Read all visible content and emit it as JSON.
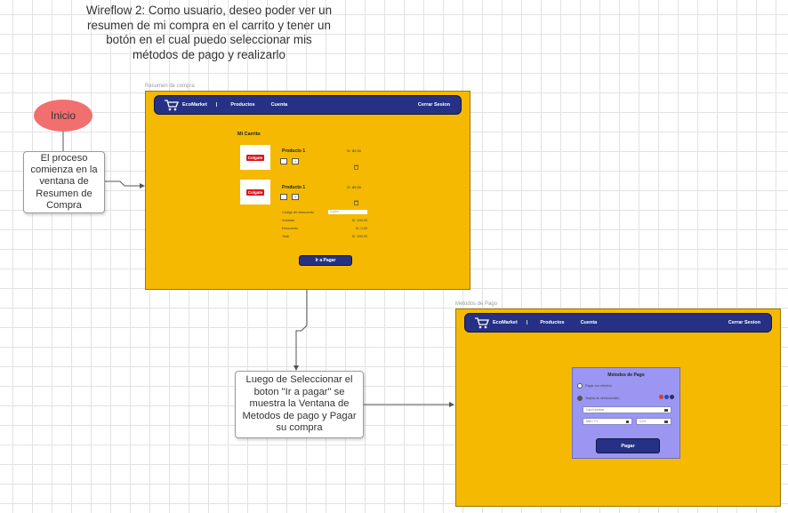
{
  "title": "Wireflow 2: Como usuario, deseo poder ver un resumen de mi compra en el carrito y tener un botón en el cual puedo seleccionar mis métodos de pago y realizarlo",
  "flow": {
    "start": "Inicio",
    "step1": "El proceso comienza en la ventana de Resumen de Compra",
    "step2": "Luego de Seleccionar el boton \"Ir a pagar\" se muestra la Ventana de Metodos de pago y Pagar su compra"
  },
  "colors": {
    "frame": "#f4b900",
    "navbar": "#263185",
    "start_node": "#f26f6f",
    "payment_panel": "#9a96f2"
  },
  "screen1": {
    "label": "Resumen de compra",
    "nav": {
      "brand": "EcoMarket",
      "sep": "|",
      "products": "Productos",
      "account": "Cuenta",
      "logout": "Cerrar Sesion",
      "icon": "shopping-cart-icon"
    },
    "cart_title": "Mi Carrito",
    "products": [
      {
        "brand": "Colgate",
        "name": "Producto 1",
        "price": "S/. 85.90"
      },
      {
        "brand": "Colgate",
        "name": "Producto 1",
        "price": "S/. 85.90"
      }
    ],
    "coupon_label": "Codigo de descuento",
    "coupon_placeholder": "Cupón",
    "subtotal_label": "Subtotal",
    "subtotal_value": "S/. 180.00",
    "discount_label": "Descuento",
    "discount_value": "S/. 0.00",
    "total_label": "Total",
    "total_value": "S/. 180.00",
    "pay_button": "Ir a Pagar"
  },
  "screen2": {
    "label": "Metodos de Pago",
    "nav": {
      "brand": "EcoMarket",
      "sep": "|",
      "products": "Productos",
      "account": "Cuenta",
      "logout": "Cerrar Sesion",
      "icon": "shopping-cart-icon"
    },
    "panel_title": "Metodos de Pago",
    "option_cash": "Pagar con efectivo",
    "option_card": "Tarjeta de debito/credito",
    "card_number_placeholder": "Card number",
    "expiry_placeholder": "MM / YY",
    "cvv_placeholder": "CVV",
    "pay_button": "Pagar"
  }
}
